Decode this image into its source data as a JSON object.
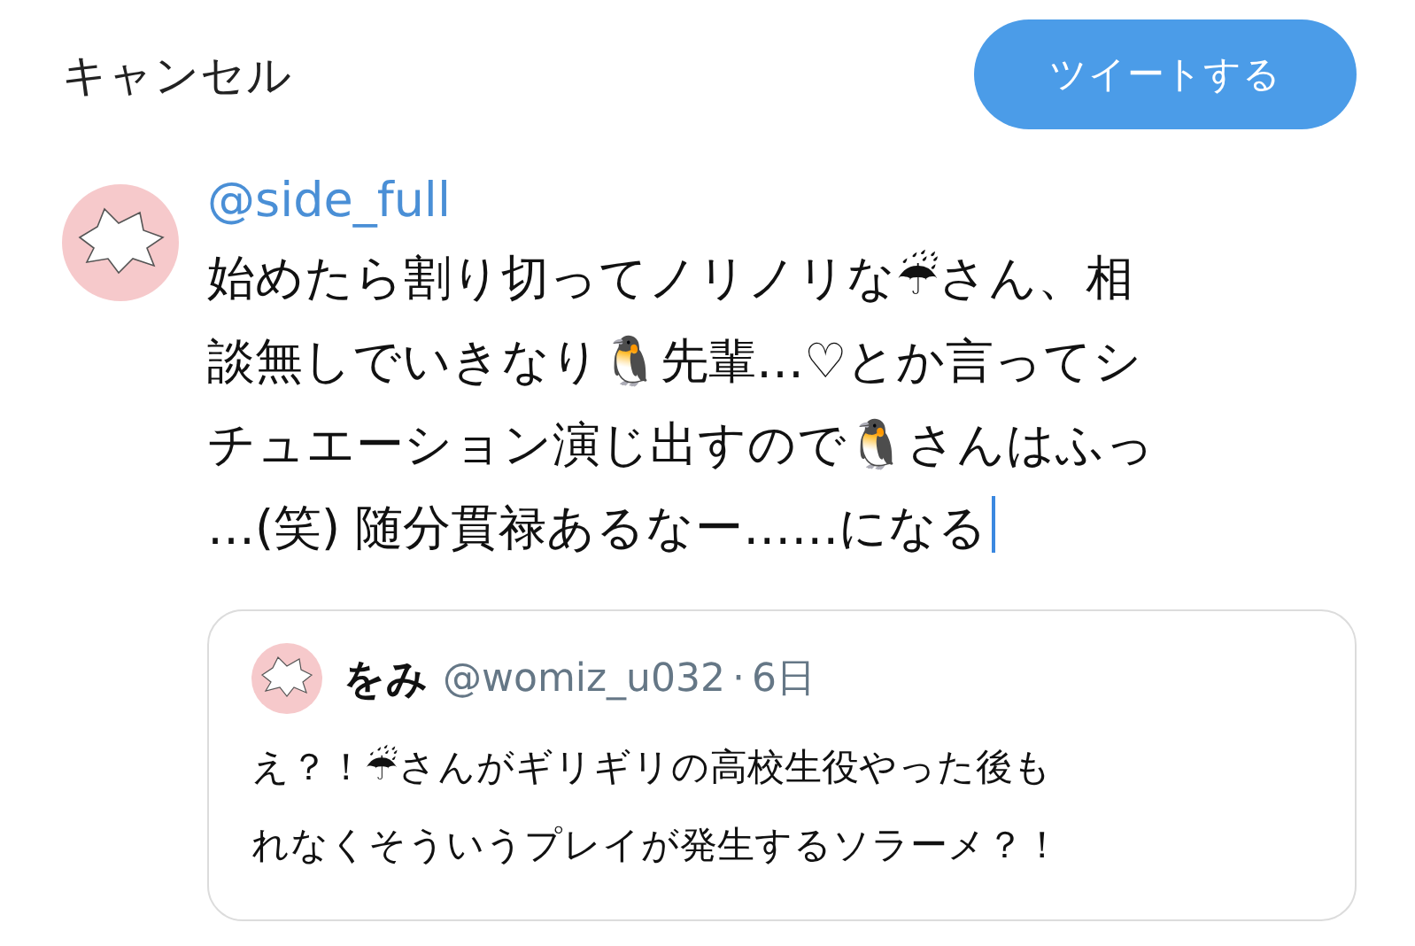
{
  "header": {
    "cancel": "キャンセル",
    "tweet_button": "ツイートする"
  },
  "compose": {
    "handle": "@side_full",
    "text": "始めたら割り切ってノリノリな☔さん、相談無しでいきなり🐧先輩…♡とか言ってシチュエーション演じ出すので🐧さんはふっ…(笑) 随分貫禄あるなー……になる",
    "cursor": true
  },
  "quote": {
    "name": "をみ",
    "handle": "@womiz_u032",
    "separator": "·",
    "time": "6日",
    "text": "え？！☔さんがギリギリの高校生役やった後もれなくそういうプレイが発生するソラーメ？！"
  }
}
